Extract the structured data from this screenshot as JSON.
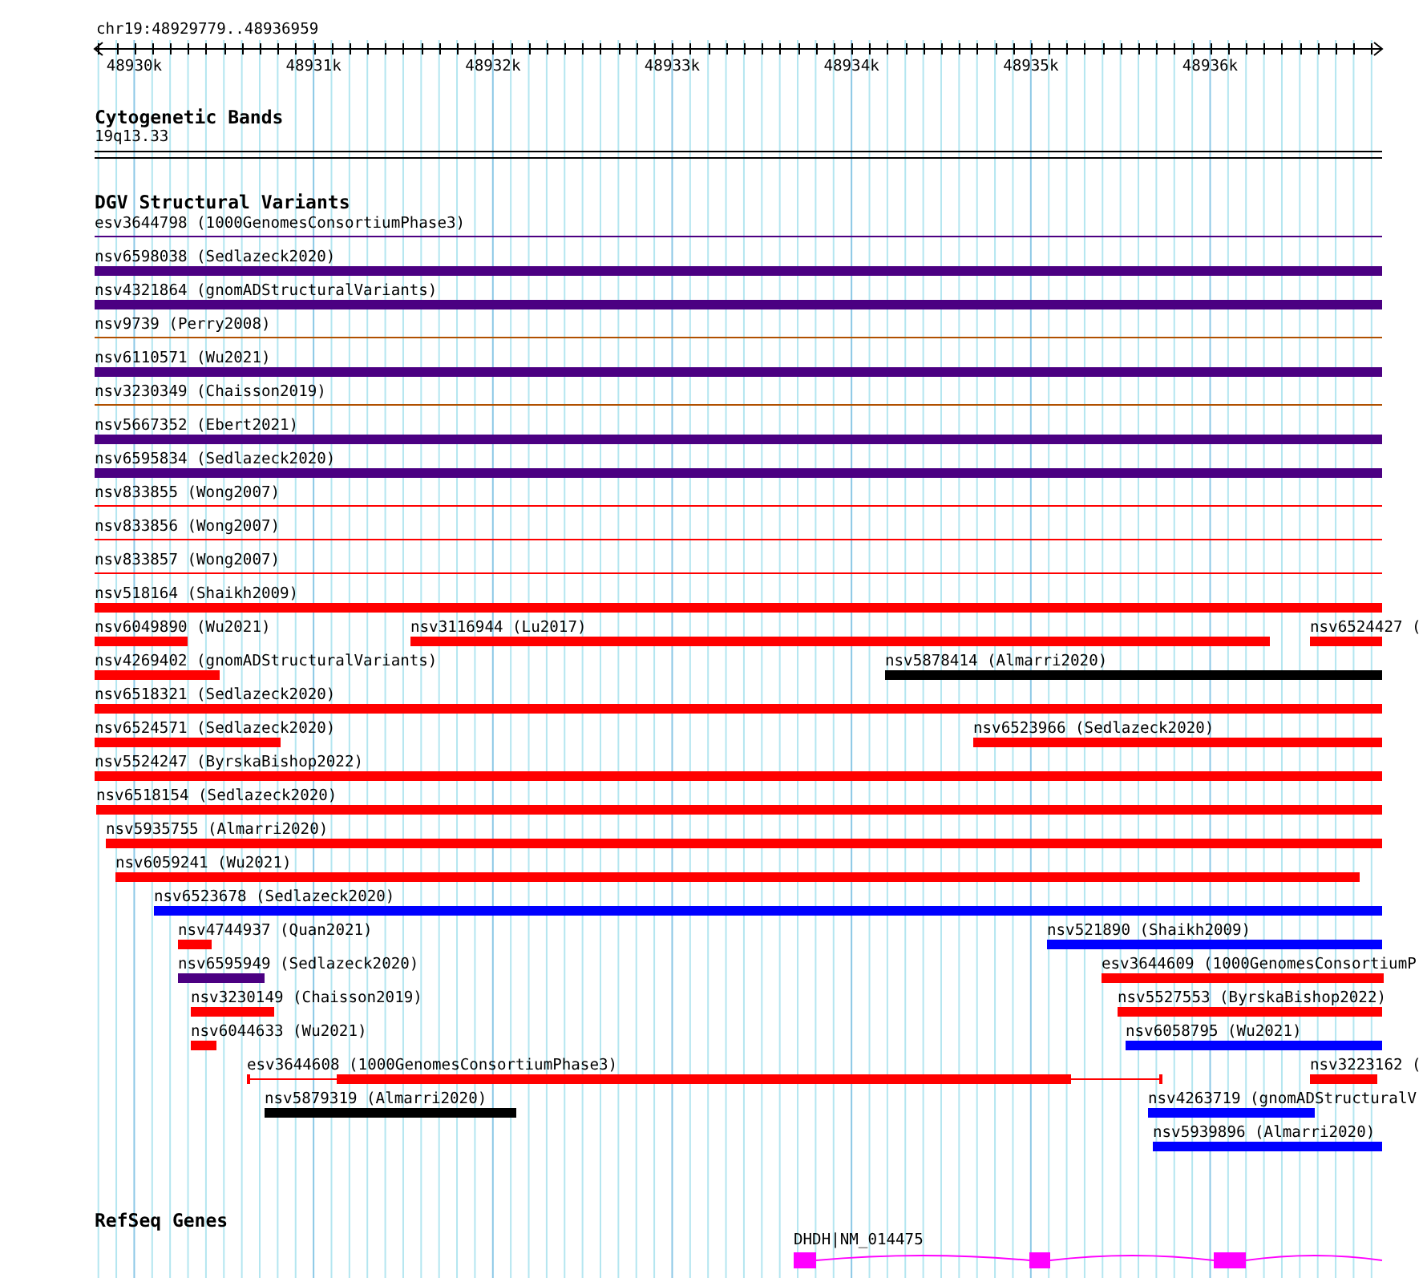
{
  "ruler": {
    "location": "chr19:48929779..48936959",
    "ticks": [
      "48930k",
      "48931k",
      "48932k",
      "48933k",
      "48934k",
      "48935k",
      "48936k"
    ]
  },
  "cytogenetic_bands": {
    "title": "Cytogenetic Bands",
    "band": "19q13.33"
  },
  "dgv_structural_variants": {
    "title": "DGV Structural Variants",
    "rows": [
      {
        "features": [
          {
            "label": "esv3644798 (1000GenomesConsortiumPhase3)",
            "kind": "line",
            "color": "#4b0082"
          }
        ]
      },
      {
        "features": [
          {
            "label": "nsv6598038 (Sedlazeck2020)",
            "kind": "bar",
            "color": "#4b0082"
          }
        ]
      },
      {
        "features": [
          {
            "label": "nsv4321864 (gnomADStructuralVariants)",
            "kind": "bar",
            "color": "#4b0082"
          }
        ]
      },
      {
        "features": [
          {
            "label": "nsv9739 (Perry2008)",
            "kind": "line",
            "color": "#b05000"
          }
        ]
      },
      {
        "features": [
          {
            "label": "nsv6110571 (Wu2021)",
            "kind": "bar",
            "color": "#4b0082"
          }
        ]
      },
      {
        "features": [
          {
            "label": "nsv3230349 (Chaisson2019)",
            "kind": "line",
            "color": "#b05000"
          }
        ]
      },
      {
        "features": [
          {
            "label": "nsv5667352 (Ebert2021)",
            "kind": "bar",
            "color": "#4b0082"
          }
        ]
      },
      {
        "features": [
          {
            "label": "nsv6595834 (Sedlazeck2020)",
            "kind": "bar",
            "color": "#4b0082"
          }
        ]
      },
      {
        "features": [
          {
            "label": "nsv833855 (Wong2007)",
            "kind": "line",
            "color": "#ff0000"
          }
        ]
      },
      {
        "features": [
          {
            "label": "nsv833856 (Wong2007)",
            "kind": "line",
            "color": "#ff0000"
          }
        ]
      },
      {
        "features": [
          {
            "label": "nsv833857 (Wong2007)",
            "kind": "line",
            "color": "#ff0000"
          }
        ]
      },
      {
        "features": [
          {
            "label": "nsv518164 (Shaikh2009)",
            "kind": "bar",
            "color": "#ff0000"
          }
        ]
      },
      {
        "features": [
          {
            "label": "nsv6049890 (Wu2021)",
            "kind": "bar",
            "color": "#ff0000"
          },
          {
            "label": "nsv3116944 (Lu2017)",
            "kind": "bar",
            "color": "#ff0000"
          },
          {
            "label": "nsv6524427 (",
            "kind": "bar",
            "color": "#ff0000"
          }
        ]
      },
      {
        "features": [
          {
            "label": "nsv4269402 (gnomADStructuralVariants)",
            "kind": "bar",
            "color": "#ff0000"
          },
          {
            "label": "nsv5878414 (Almarri2020)",
            "kind": "bar",
            "color": "#000000"
          }
        ]
      },
      {
        "features": [
          {
            "label": "nsv6518321 (Sedlazeck2020)",
            "kind": "bar",
            "color": "#ff0000"
          }
        ]
      },
      {
        "features": [
          {
            "label": "nsv6524571 (Sedlazeck2020)",
            "kind": "bar",
            "color": "#ff0000"
          },
          {
            "label": "nsv6523966 (Sedlazeck2020)",
            "kind": "bar",
            "color": "#ff0000"
          }
        ]
      },
      {
        "features": [
          {
            "label": "nsv5524247 (ByrskaBishop2022)",
            "kind": "bar",
            "color": "#ff0000"
          }
        ]
      },
      {
        "features": [
          {
            "label": "nsv6518154 (Sedlazeck2020)",
            "kind": "bar",
            "color": "#ff0000"
          }
        ]
      },
      {
        "features": [
          {
            "label": "nsv5935755 (Almarri2020)",
            "kind": "bar",
            "color": "#ff0000"
          }
        ]
      },
      {
        "features": [
          {
            "label": "nsv6059241 (Wu2021)",
            "kind": "bar",
            "color": "#ff0000"
          }
        ]
      },
      {
        "features": [
          {
            "label": "nsv6523678 (Sedlazeck2020)",
            "kind": "bar",
            "color": "#0000ff"
          }
        ]
      },
      {
        "features": [
          {
            "label": "nsv4744937 (Quan2021)",
            "kind": "bar",
            "color": "#ff0000"
          },
          {
            "label": "nsv521890 (Shaikh2009)",
            "kind": "bar",
            "color": "#0000ff"
          }
        ]
      },
      {
        "features": [
          {
            "label": "nsv6595949 (Sedlazeck2020)",
            "kind": "bar",
            "color": "#4b0082"
          },
          {
            "label": "esv3644609 (1000GenomesConsortiumP",
            "kind": "ci_bar",
            "color": "#ff0000"
          }
        ]
      },
      {
        "features": [
          {
            "label": "nsv3230149 (Chaisson2019)",
            "kind": "bar",
            "color": "#ff0000"
          },
          {
            "label": "nsv5527553 (ByrskaBishop2022)",
            "kind": "bar",
            "color": "#ff0000"
          }
        ]
      },
      {
        "features": [
          {
            "label": "nsv6044633 (Wu2021)",
            "kind": "bar",
            "color": "#ff0000"
          },
          {
            "label": "nsv6058795 (Wu2021)",
            "kind": "bar",
            "color": "#0000ff"
          }
        ]
      },
      {
        "features": [
          {
            "label": "esv3644608 (1000GenomesConsortiumPhase3)",
            "kind": "ci_bar",
            "color": "#ff0000"
          },
          {
            "label": "nsv3223162 (",
            "kind": "bar",
            "color": "#ff0000"
          }
        ]
      },
      {
        "features": [
          {
            "label": "nsv5879319 (Almarri2020)",
            "kind": "bar",
            "color": "#000000"
          },
          {
            "label": "nsv4263719 (gnomADStructuralV",
            "kind": "bar",
            "color": "#0000ff"
          }
        ]
      },
      {
        "features": [
          {
            "label": "nsv5939896 (Almarri2020)",
            "kind": "bar",
            "color": "#0000ff"
          }
        ]
      }
    ]
  },
  "refseq_genes": {
    "title": "RefSeq Genes",
    "genes": [
      {
        "label": "DHDH|NM_014475"
      }
    ]
  }
}
